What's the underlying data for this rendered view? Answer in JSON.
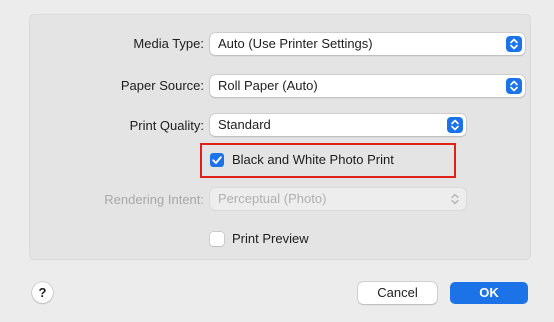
{
  "form": {
    "media_type": {
      "label": "Media Type:",
      "value": "Auto (Use Printer Settings)"
    },
    "paper_source": {
      "label": "Paper Source:",
      "value": "Roll Paper (Auto)"
    },
    "print_quality": {
      "label": "Print Quality:",
      "value": "Standard"
    },
    "bw_photo_print": {
      "label": "Black and White Photo Print",
      "checked": true
    },
    "rendering_intent": {
      "label": "Rendering Intent:",
      "value": "Perceptual (Photo)",
      "enabled": false
    },
    "print_preview": {
      "label": "Print Preview",
      "checked": false
    }
  },
  "footer": {
    "help_label": "?",
    "cancel_label": "Cancel",
    "ok_label": "OK"
  },
  "colors": {
    "accent": "#1c73e8",
    "highlight_border": "#e0201b",
    "window_background": "#ececec"
  },
  "icons": {
    "popup_arrows": "chevron-up-down-icon",
    "checkmark": "checkmark-icon"
  }
}
